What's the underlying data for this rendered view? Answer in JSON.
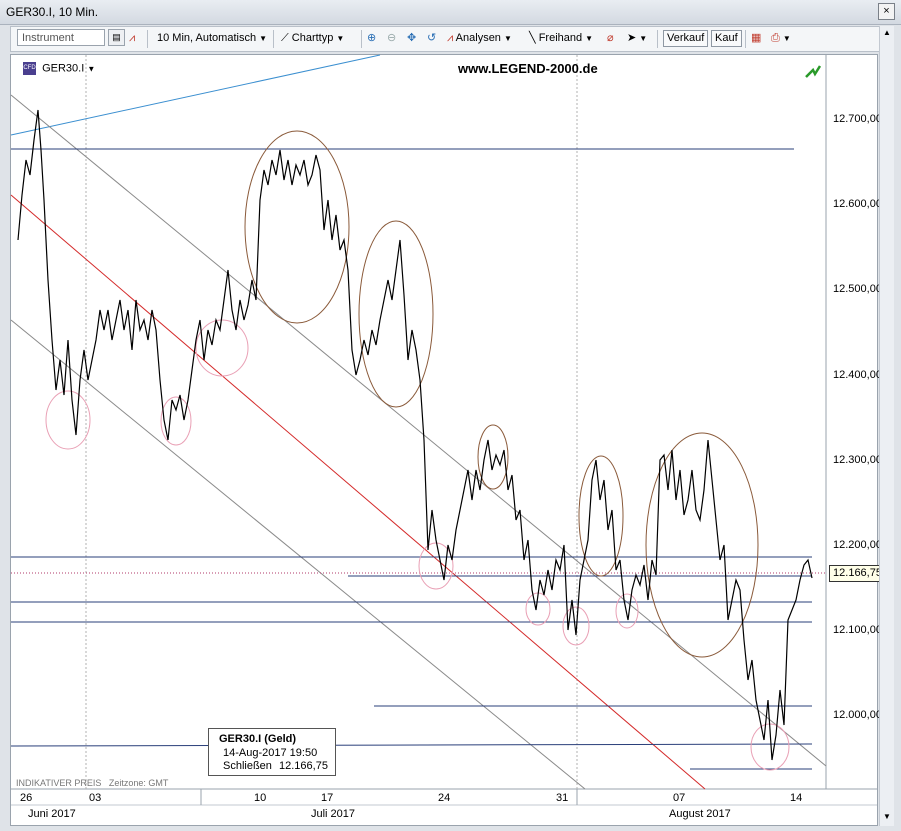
{
  "window": {
    "title": "GER30.I, 10 Min.",
    "close_glyph": "×"
  },
  "toolbar": {
    "instrument_placeholder": "Instrument",
    "interval_label": "10 Min,",
    "scale_label": "Automatisch",
    "charttype_label": "Charttyp",
    "analyses_label": "Analysen",
    "freehand_label": "Freihand",
    "sell_label": "Verkauf",
    "buy_label": "Kauf",
    "icons": [
      "instrument-picker-icon",
      "indicator-icon",
      "line-chart-icon",
      "zoom-in-icon",
      "zoom-out-icon",
      "pan-icon",
      "undo-icon",
      "analysis-icon",
      "freehand-pen-icon",
      "eraser-icon",
      "cursor-icon",
      "chart-settings-icon",
      "print-icon"
    ]
  },
  "chart": {
    "symbol": "GER30.I",
    "watermark": "www.LEGEND-2000.de",
    "price_axis": [
      "12.700,00",
      "12.600,00",
      "12.500,00",
      "12.400,00",
      "12.300,00",
      "12.200,00",
      "12.100,00",
      "12.000,00"
    ],
    "current_price": "12.166,75",
    "date_axis_top": [
      "26",
      "03",
      "10",
      "17",
      "24",
      "31",
      "07",
      "14"
    ],
    "date_axis_bottom": [
      "Juni 2017",
      "Juli 2017",
      "August 2017"
    ],
    "footer_note": "INDIKATIVER PREIS",
    "timezone_note": "Zeitzone: GMT",
    "legend": {
      "title": "GER30.I (Geld)",
      "datetime": "14-Aug-2017 19:50",
      "close_label": "Schließen",
      "close_value": "12.166,75"
    },
    "colors": {
      "price_line": "#000000",
      "trend_red": "#d42a2a",
      "channel_gray": "#8a8a8a",
      "hline_blue": "#2a3f7a",
      "ellipse_brown": "#8a5a3a",
      "ellipse_pink": "#e9a0b5",
      "blue_trend": "#3b8fd0"
    }
  }
}
